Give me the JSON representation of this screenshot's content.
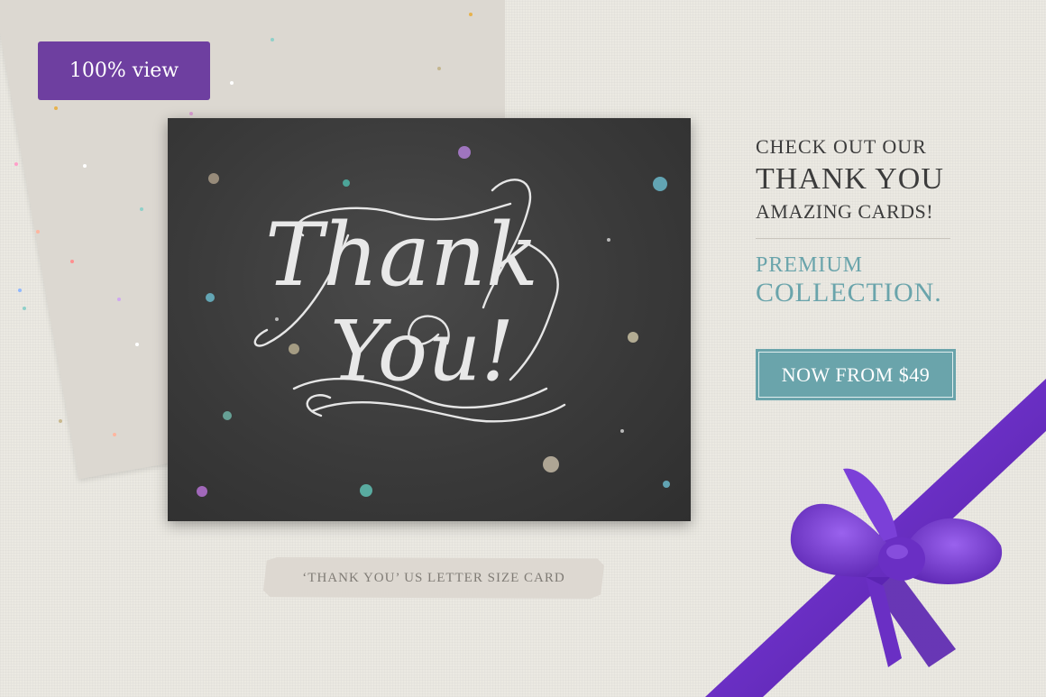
{
  "badge": {
    "label": "100% view"
  },
  "card": {
    "script_line1": "Thank",
    "script_line2": "You!"
  },
  "promo": {
    "line1": "CHECK OUT OUR",
    "line2": "THANK YOU",
    "line3": "AMAZING CARDS!",
    "line4": "PREMIUM",
    "line5": "COLLECTION."
  },
  "price_button": {
    "label": "NOW FROM $49"
  },
  "caption": {
    "label": "‘THANK YOU’ US LETTER SIZE CARD"
  },
  "colors": {
    "background": "#ebe9e2",
    "badge": "#6e3fa0",
    "accent": "#6aa4ab",
    "card": "#3a3a3a",
    "ribbon": "#6a2fc4",
    "envelope": "#dcd8d1"
  },
  "icons": [
    "purple-ribbon-bow-icon"
  ]
}
